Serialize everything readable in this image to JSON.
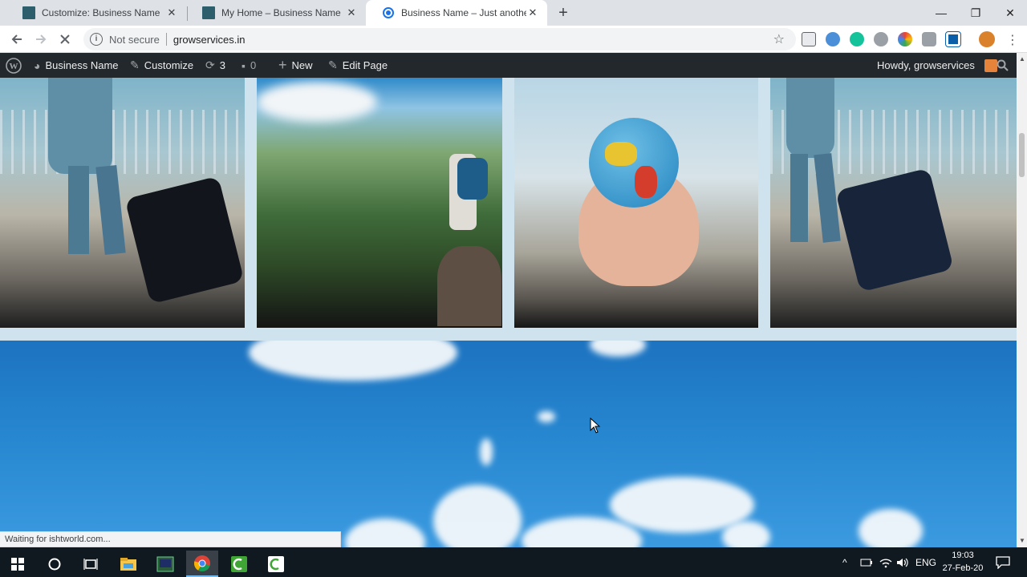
{
  "browser": {
    "tabs": [
      {
        "title": "Customize: Business Name",
        "active": false
      },
      {
        "title": "My Home – Business Name",
        "active": false
      },
      {
        "title": "Business Name – Just another W",
        "active": true
      }
    ],
    "new_tab": "+",
    "close_glyph": "✕",
    "window_controls": {
      "minimize": "—",
      "maximize": "❐",
      "close": "✕"
    },
    "security": "Not secure",
    "url": "growservices.in",
    "status": "Waiting for ishtworld.com..."
  },
  "adminbar": {
    "site_name": "Business Name",
    "customize": "Customize",
    "updates_count": "3",
    "comments_count": "0",
    "new_label": "New",
    "edit_page": "Edit Page",
    "howdy": "Howdy, growservices"
  },
  "gallery": {
    "images": [
      {
        "subject": "traveler with rolling suitcase"
      },
      {
        "subject": "hiker on mountain"
      },
      {
        "subject": "hand holding globe"
      },
      {
        "subject": "traveler with rolling suitcase"
      }
    ]
  },
  "taskbar": {
    "language": "ENG",
    "time": "19:03",
    "date": "27-Feb-20"
  },
  "colors": {
    "admin_bar": "#23282d",
    "tab_strip": "#dee1e6",
    "sky": "#2686cf",
    "taskbar": "#101820"
  }
}
